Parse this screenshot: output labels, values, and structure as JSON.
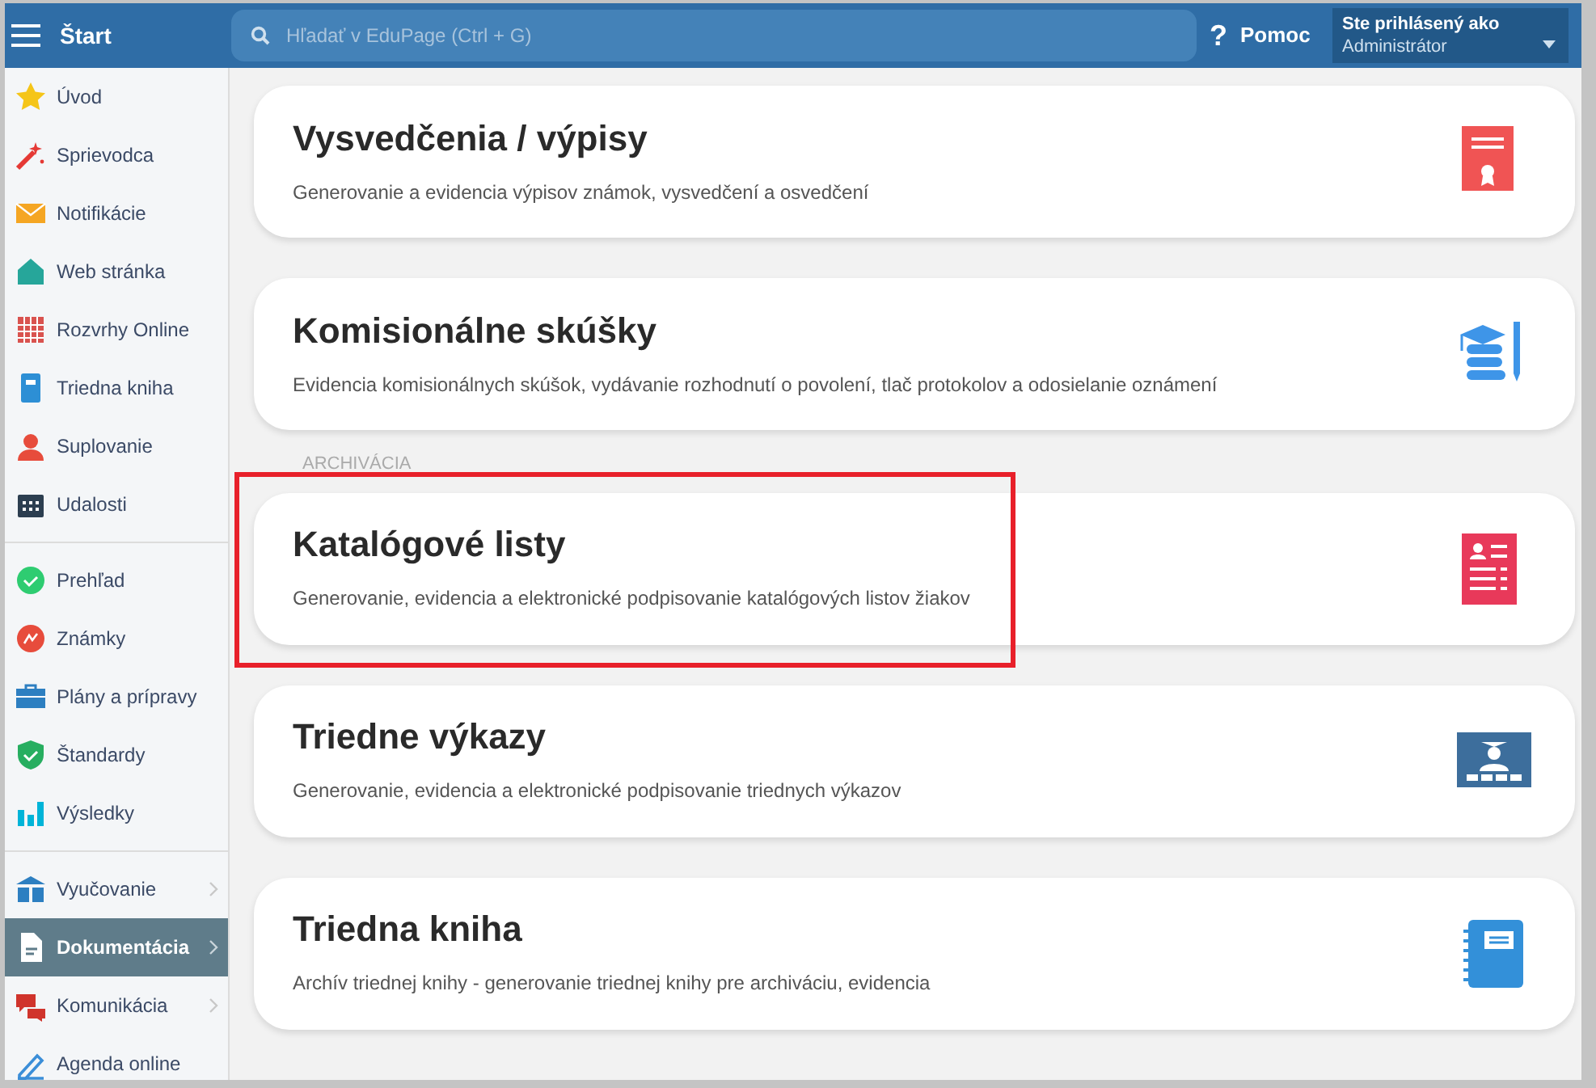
{
  "header": {
    "title": "Štart",
    "search": {
      "placeholder": "Hľadať v EduPage (Ctrl + G)"
    },
    "help_icon": "?",
    "help": "Pomoc",
    "login": {
      "label": "Ste prihlásený ako",
      "user": "Administrátor"
    }
  },
  "sidebar": {
    "groups": [
      {
        "items": [
          {
            "label": "Úvod",
            "selected": false
          },
          {
            "label": "Sprievodca",
            "selected": false
          },
          {
            "label": "Notifikácie",
            "selected": false
          },
          {
            "label": "Web stránka",
            "selected": false
          },
          {
            "label": "Rozvrhy Online",
            "selected": false
          },
          {
            "label": "Triedna kniha",
            "selected": false
          },
          {
            "label": "Suplovanie",
            "selected": false
          },
          {
            "label": "Udalosti",
            "selected": false
          }
        ]
      },
      {
        "items": [
          {
            "label": "Prehľad",
            "selected": false
          },
          {
            "label": "Známky",
            "selected": false
          },
          {
            "label": "Plány a prípravy",
            "selected": false
          },
          {
            "label": "Štandardy",
            "selected": false
          },
          {
            "label": "Výsledky",
            "selected": false
          }
        ]
      },
      {
        "items": [
          {
            "label": "Vyučovanie",
            "selected": false,
            "expandable": true
          },
          {
            "label": "Dokumentácia",
            "selected": true,
            "expandable": true
          },
          {
            "label": "Komunikácia",
            "selected": false,
            "expandable": true
          },
          {
            "label": "Agenda online",
            "selected": false,
            "expandable": false
          }
        ]
      }
    ]
  },
  "sections": [
    {
      "cards": [
        {
          "title": "Vysvedčenia / výpisy",
          "description": "Generovanie a evidencia výpisov známok, vysvedčení a osvedčení",
          "highlighted": false
        },
        {
          "title": "Komisionálne skúšky",
          "description": "Evidencia komisionálnych skúšok, vydávanie rozhodnutí o povolení, tlač protokolov a odosielanie oznámení",
          "highlighted": false
        }
      ]
    },
    {
      "label": "ARCHIVÁCIA",
      "cards": [
        {
          "title": "Katalógové listy",
          "description": "Generovanie, evidencia a elektronické podpisovanie katalógových listov žiakov",
          "highlighted": true
        },
        {
          "title": "Triedne výkazy",
          "description": "Generovanie, evidencia a elektronické podpisovanie triednych výkazov",
          "highlighted": false
        },
        {
          "title": "Triedna kniha",
          "description": "Archív triednej knihy - generovanie triednej knihy pre archiváciu, evidencia",
          "highlighted": false
        }
      ]
    }
  ]
}
